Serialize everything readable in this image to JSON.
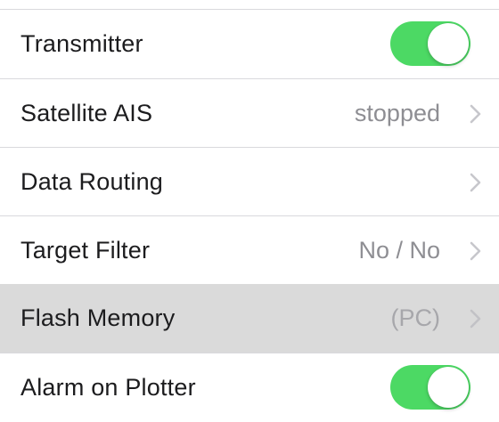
{
  "settings": {
    "accent_color": "#4cd964",
    "rows": [
      {
        "label": "Transmitter",
        "control": "toggle",
        "toggle_on": true
      },
      {
        "label": "Satellite AIS",
        "value": "stopped",
        "control": "chevron"
      },
      {
        "label": "Data Routing",
        "value": "",
        "control": "chevron"
      },
      {
        "label": "Target Filter",
        "value": "No / No",
        "control": "chevron"
      },
      {
        "label": "Flash Memory",
        "value": "(PC)",
        "control": "chevron",
        "highlighted": true
      },
      {
        "label": "Alarm on Plotter",
        "control": "toggle",
        "toggle_on": true
      }
    ]
  }
}
